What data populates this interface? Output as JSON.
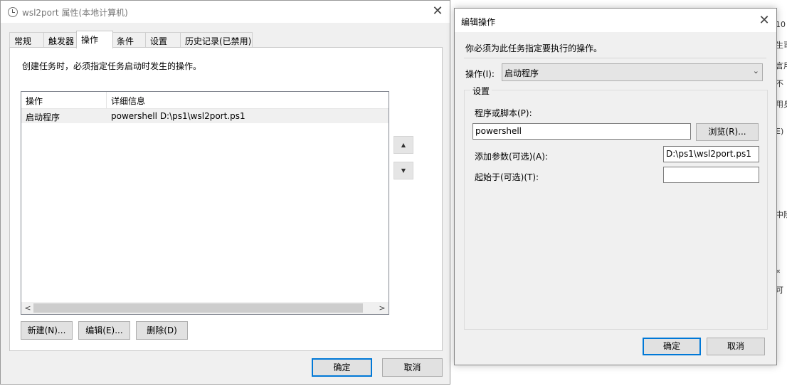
{
  "main_dialog": {
    "title": "wsl2port 属性(本地计算机)",
    "close_glyph": "✕",
    "tabs": [
      "常规",
      "触发器",
      "操作",
      "条件",
      "设置",
      "历史记录(已禁用)"
    ],
    "description": "创建任务时，必须指定任务启动时发生的操作。",
    "list": {
      "columns": [
        "操作",
        "详细信息"
      ],
      "rows": [
        {
          "action": "启动程序",
          "details": "powershell D:\\ps1\\wsl2port.ps1"
        }
      ],
      "scroll_left": "<",
      "scroll_right": ">"
    },
    "move_up_glyph": "▲",
    "move_down_glyph": "▼",
    "buttons": {
      "new": "新建(N)...",
      "edit": "编辑(E)...",
      "delete": "删除(D)"
    },
    "footer": {
      "ok": "确定",
      "cancel": "取消"
    }
  },
  "edit_dialog": {
    "title": "编辑操作",
    "close_glyph": "✕",
    "instruction": "你必须为此任务指定要执行的操作。",
    "action_label": "操作(I):",
    "action_value": "启动程序",
    "dropdown_glyph": "⌄",
    "settings_group": "设置",
    "program_label": "程序或脚本(P):",
    "program_value": "powershell",
    "browse": "浏览(R)...",
    "args_label": "添加参数(可选)(A):",
    "args_value": "D:\\ps1\\wsl2port.ps1",
    "start_in_label": "起始于(可选)(T):",
    "start_in_value": "",
    "ok": "确定",
    "cancel": "取消"
  },
  "background_fragments": [
    "10",
    "生司",
    "言用",
    "不",
    "用身",
    "E)",
    "中阶",
    "«",
    "可"
  ]
}
